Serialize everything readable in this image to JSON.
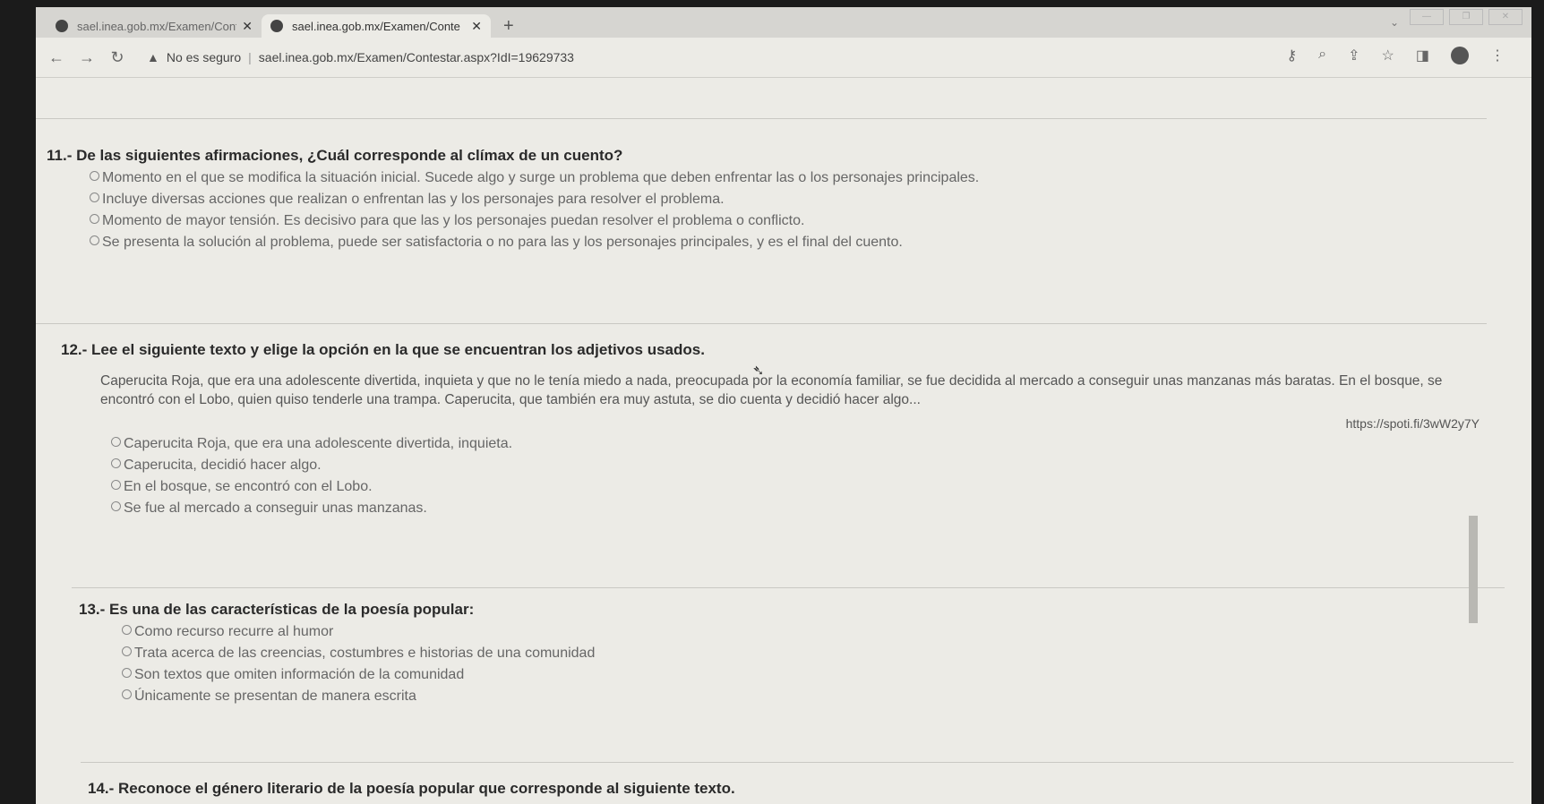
{
  "browser": {
    "tabs": [
      {
        "label": "sael.inea.gob.mx/Examen/Conte",
        "close": "✕"
      },
      {
        "label": "sael.inea.gob.mx/Examen/Conte",
        "close": "✕"
      }
    ],
    "new_tab": "+",
    "security": "No es seguro",
    "url": "sael.inea.gob.mx/Examen/Contestar.aspx?IdI=19629733"
  },
  "questions": [
    {
      "number": "11.-",
      "title": "De las siguientes afirmaciones, ¿Cuál corresponde al clímax de un cuento?",
      "options": [
        "Momento en el que se modifica la situación inicial. Sucede algo y surge un problema que deben enfrentar las o los personajes principales.",
        "Incluye diversas acciones que realizan o enfrentan las y los personajes para resolver el problema.",
        "Momento de mayor tensión. Es decisivo para que las y los personajes puedan resolver el problema o conflicto.",
        "Se presenta la solución al problema, puede ser satisfactoria o no para las y los personajes principales, y es el final del cuento."
      ]
    },
    {
      "number": "12.-",
      "title": "Lee el siguiente texto y elige la opción en la que se encuentran los adjetivos usados.",
      "passage": "Caperucita Roja, que era una adolescente divertida, inquieta y que no le tenía miedo a nada, preocupada por la economía familiar, se fue decidida al mercado a conseguir unas manzanas más baratas. En el bosque, se encontró con el Lobo, quien quiso tenderle una trampa. Caperucita, que también era muy astuta, se dio cuenta y decidió hacer algo...",
      "source": "https://spoti.fi/3wW2y7Y",
      "options": [
        "Caperucita Roja, que era una adolescente divertida, inquieta.",
        "Caperucita, decidió hacer algo.",
        "En el bosque, se encontró con el Lobo.",
        "Se fue al mercado a conseguir unas manzanas."
      ]
    },
    {
      "number": "13.-",
      "title": "Es una de las características de la poesía popular:",
      "options": [
        "Como recurso recurre al humor",
        "Trata acerca de las creencias, costumbres e historias de una comunidad",
        "Son textos que omiten información de la comunidad",
        "Únicamente se presentan de manera escrita"
      ]
    },
    {
      "number": "14.-",
      "title": "Reconoce el género literario de la poesía popular que corresponde al siguiente texto."
    }
  ]
}
